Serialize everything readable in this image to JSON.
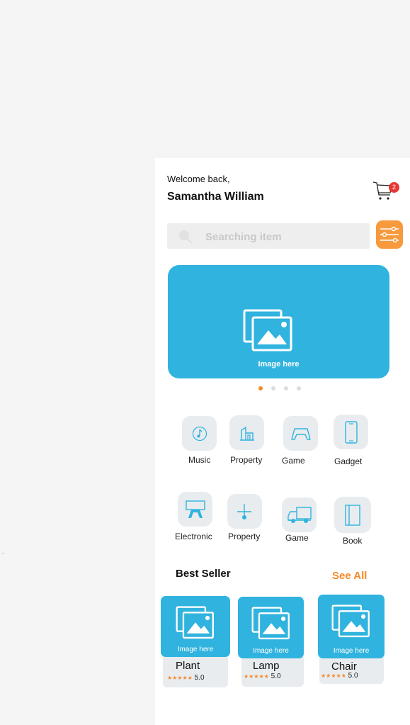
{
  "header": {
    "welcome": "Welcome back,",
    "username": "Samantha William",
    "cart_count": "2",
    "cart_icon": "cart-icon"
  },
  "search": {
    "placeholder": "Searching item",
    "icon": "search-icon",
    "filter_icon": "sliders-icon"
  },
  "banner": {
    "image_text": "Image here",
    "slide_count": 4,
    "active_slide": 1
  },
  "categories": [
    {
      "label": "Music",
      "icon": "music-icon"
    },
    {
      "label": "Property",
      "icon": "building-icon"
    },
    {
      "label": "Game",
      "icon": "game-controller-icon"
    },
    {
      "label": "Gadget",
      "icon": "phone-icon"
    },
    {
      "label": "Electronic",
      "icon": "monitor-icon"
    },
    {
      "label": "Property",
      "icon": "property-icon"
    },
    {
      "label": "Game",
      "icon": "truck-icon"
    },
    {
      "label": "Book",
      "icon": "book-icon"
    }
  ],
  "best_seller": {
    "title": "Best Seller",
    "see_all": "See All",
    "products": [
      {
        "name": "Plant",
        "image_text": "Image here",
        "stars": "★★★★★",
        "rating": "5.0"
      },
      {
        "name": "Lamp",
        "image_text": "Image here",
        "stars": "★★★★★",
        "rating": "5.0"
      },
      {
        "name": "Chair",
        "image_text": "Image here",
        "stars": "★★★★★",
        "rating": "5.0"
      }
    ]
  },
  "colors": {
    "accent": "#30b3de",
    "orange": "#f79a3e",
    "badge": "#e53935"
  }
}
